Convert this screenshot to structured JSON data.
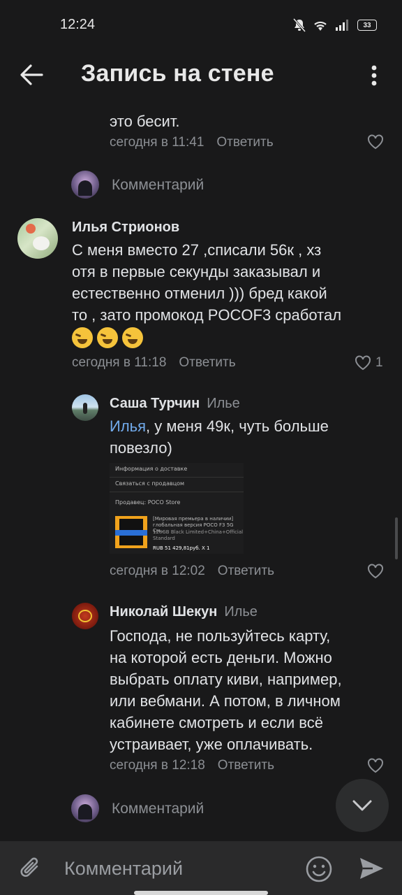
{
  "status": {
    "time": "12:24",
    "battery": "33"
  },
  "header": {
    "title": "Запись на стене"
  },
  "partial_comment": {
    "text_last_line": "это бесит.",
    "time": "сегодня в 11:41",
    "reply_label": "Ответить"
  },
  "comment_prompt_1": {
    "placeholder": "Комментарий"
  },
  "comment_main": {
    "author": "Илья Стрионов",
    "lines": [
      "С меня вместо 27 ,списали 56к , хз",
      "отя в первые секунды заказывал и",
      "естественно отменил ))) бред какой",
      "то , зато промокод POCOF3 сработал"
    ],
    "emoji": [
      "rofl-emoji",
      "rofl-emoji",
      "rofl-emoji"
    ],
    "time": "сегодня в 11:18",
    "reply_label": "Ответить",
    "likes": "1"
  },
  "reply_1": {
    "author": "Саша Турчин",
    "reply_to": "Илье",
    "mention": "Илья",
    "text_after_mention": ", у меня 49к, чуть больше",
    "text_line2": "повезло)",
    "attachment": {
      "row1": "Информация о доставке",
      "row2": "Связаться с продавцом",
      "row3": "Продавец: POCO Store",
      "item_title": "[Мировая премьера в наличии]",
      "item_line2": "глобальная версия POCO F3 5G См...",
      "item_line3": "128GB Black Limited+China+Official",
      "item_line4": "Standard",
      "item_price": "RUB 51 429,81руб. X 1"
    },
    "time": "сегодня в 12:02",
    "reply_label": "Ответить"
  },
  "reply_2": {
    "author": "Николай Шекун",
    "reply_to": "Илье",
    "lines": [
      "Господа, не пользуйтесь карту,",
      "на которой есть деньги. Можно",
      "выбрать оплату киви, например,",
      "или вебмани. А потом, в личном",
      "кабинете смотреть и если всё",
      "устраивает, уже оплачивать."
    ],
    "time": "сегодня в 12:18",
    "reply_label": "Ответить"
  },
  "comment_prompt_2": {
    "placeholder": "Комментарий"
  },
  "bottom_bar": {
    "placeholder": "Комментарий"
  },
  "colors": {
    "background": "#19191a",
    "mention": "#71aaeb",
    "secondary_text": "#8c8f94"
  }
}
